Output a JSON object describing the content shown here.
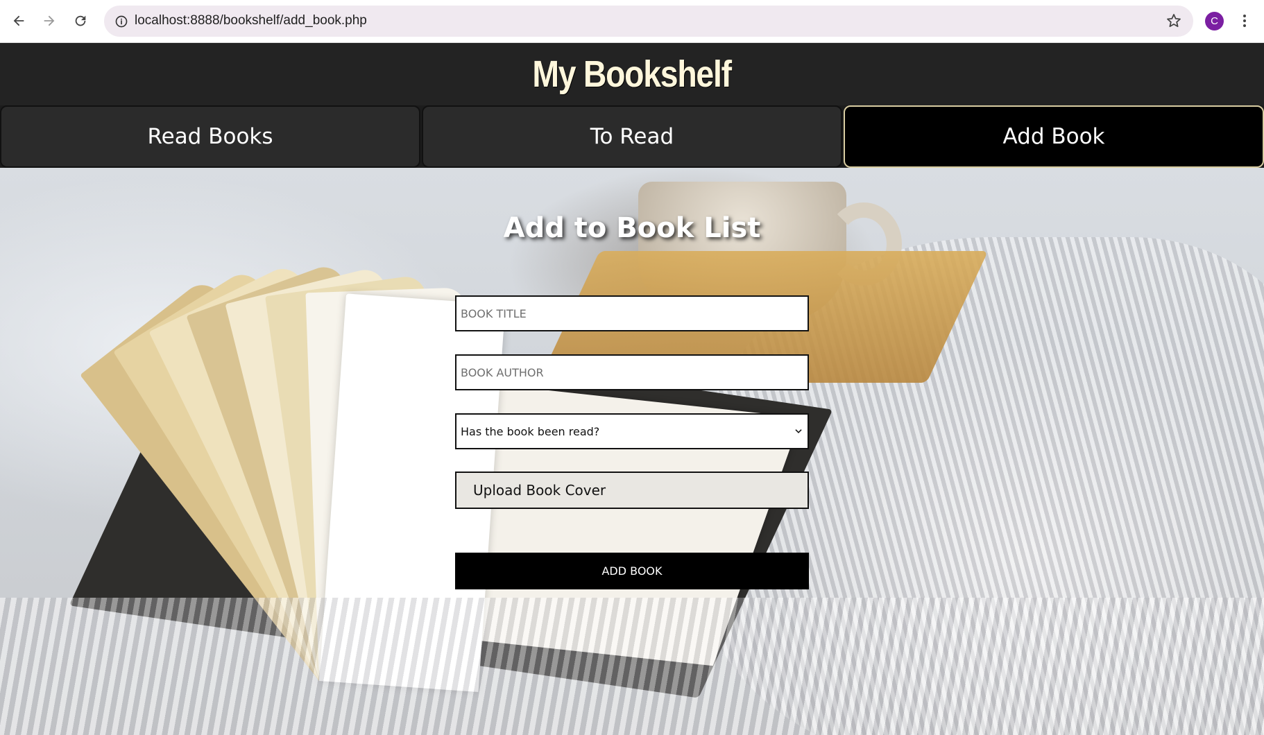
{
  "browser": {
    "url": "localhost:8888/bookshelf/add_book.php",
    "profile_initial": "C"
  },
  "site": {
    "title": "My Bookshelf"
  },
  "tabs": [
    {
      "label": "Read Books",
      "active": false
    },
    {
      "label": "To Read",
      "active": false
    },
    {
      "label": "Add Book",
      "active": true
    }
  ],
  "form": {
    "heading": "Add to Book List",
    "title_placeholder": "BOOK TITLE",
    "author_placeholder": "BOOK AUTHOR",
    "read_status_selected": "Has the book been read?",
    "upload_label": "Upload Book Cover",
    "submit_label": "ADD BOOK"
  },
  "colors": {
    "header_bg": "#232323",
    "title_color": "#fff7dc",
    "active_tab_border": "#d9cda2"
  }
}
